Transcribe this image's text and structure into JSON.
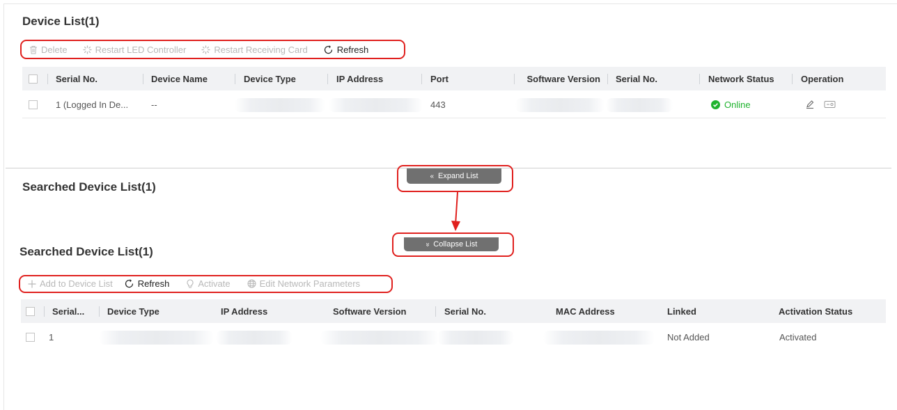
{
  "device_list": {
    "title": "Device List(1)",
    "toolbar": {
      "delete": "Delete",
      "restart_led": "Restart LED Controller",
      "restart_receiving": "Restart Receiving Card",
      "refresh": "Refresh"
    },
    "columns": [
      "Serial No.",
      "Device Name",
      "Device Type",
      "IP Address",
      "Port",
      "Software Version",
      "Serial No.",
      "Network Status",
      "Operation"
    ],
    "rows": [
      {
        "serial": "1 (Logged In De...",
        "device_name": "--",
        "port": "443",
        "status": "Online"
      }
    ]
  },
  "expand_button": {
    "label": "Expand List",
    "icon": "chevron-double-up-icon"
  },
  "collapse_button": {
    "label": "Collapse List",
    "icon": "chevron-double-down-icon"
  },
  "searched_collapsed": {
    "title": "Searched Device List(1)"
  },
  "searched_list": {
    "title": "Searched Device List(1)",
    "toolbar": {
      "add": "Add to Device List",
      "refresh": "Refresh",
      "activate": "Activate",
      "edit_network": "Edit Network Parameters"
    },
    "columns": [
      "Serial...",
      "Device Type",
      "IP Address",
      "Software Version",
      "Serial No.",
      "MAC Address",
      "Linked",
      "Activation Status"
    ],
    "rows": [
      {
        "serial": "1",
        "linked": "Not Added",
        "activation_status": "Activated"
      }
    ]
  },
  "colors": {
    "annotation": "#e0201e",
    "online": "#1fb32e",
    "header_bg": "#f1f2f4",
    "pill_bg": "#707070",
    "disabled_text": "#b8b8b8"
  }
}
